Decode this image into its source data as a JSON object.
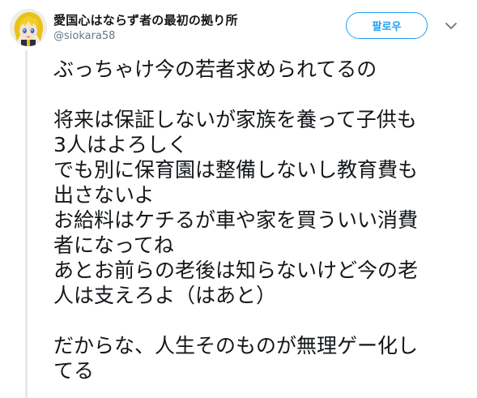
{
  "author": {
    "display_name": "愛国心はならず者の最初の拠り所",
    "handle": "@siokara58"
  },
  "actions": {
    "follow_label": "팔로우"
  },
  "tweet": {
    "lines": [
      "ぶっちゃけ今の若者求められてるの",
      "",
      "将来は保証しないが家族を養って子供も",
      "3人はよろしく",
      "でも別に保育園は整備しないし教育費も",
      "出さないよ",
      "お給料はケチるが車や家を買ういい消費",
      "者になってね",
      "あとお前らの老後は知らないけど今の老",
      "人は支えろよ（はあと）",
      "",
      "だからな、人生そのものが無理ゲー化し",
      "てる"
    ]
  },
  "icons": {
    "avatar": "anime-character-avatar",
    "caret": "chevron-down-icon"
  },
  "colors": {
    "accent": "#1da1f2",
    "text": "#14171a",
    "muted": "#657786",
    "rule": "#e1e8ed"
  }
}
